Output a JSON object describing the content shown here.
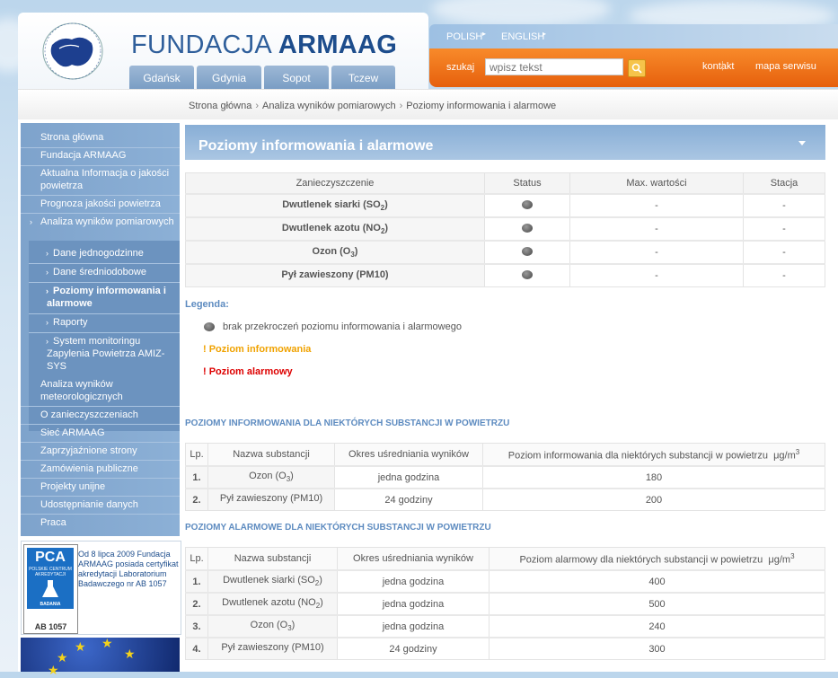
{
  "header": {
    "brand_regular": "FUNDACJA",
    "brand_bold": "ARMAAG",
    "city_tabs": [
      "Gdańsk",
      "Gdynia",
      "Sopot",
      "Tczew"
    ],
    "languages": [
      "POLISH",
      "ENGLISH"
    ],
    "search_label": "szukaj",
    "search_placeholder": "wpisz tekst",
    "links": [
      "kontakt",
      "mapa serwisu"
    ]
  },
  "breadcrumb": [
    "Strona główna",
    "Analiza wyników pomiarowych",
    "Poziomy informowania i alarmowe"
  ],
  "sidebar": {
    "items": [
      {
        "label": "Strona główna"
      },
      {
        "label": "Fundacja ARMAAG"
      },
      {
        "label": "Aktualna Informacja o jakości powietrza"
      },
      {
        "label": "Prognoza jakości powietrza"
      },
      {
        "label": "Analiza wyników pomiarowych"
      },
      {
        "label": "Dane jednogodzinne"
      },
      {
        "label": "Dane średniodobowe"
      },
      {
        "label": "Poziomy informowania i alarmowe"
      },
      {
        "label": "Raporty"
      },
      {
        "label": "System monitoringu Zapylenia Powietrza AMIZ-SYS"
      },
      {
        "label": "Analiza wyników meteorologicznych"
      },
      {
        "label": "O zanieczyszczeniach"
      },
      {
        "label": "Sieć ARMAAG"
      },
      {
        "label": "Zaprzyjaźnione strony"
      },
      {
        "label": "Zamówienia publiczne"
      },
      {
        "label": "Projekty unijne"
      },
      {
        "label": "Udostępnianie danych"
      },
      {
        "label": "Praca"
      }
    ]
  },
  "pca": {
    "logo_text": "PCA",
    "logo_sub": "POLSKIE CENTRUM AKREDYTACJI",
    "logo_badania": "BADANIA",
    "code": "AB 1057",
    "text": "Od 8 lipca 2009 Fundacja ARMAAG posiada certyfikat akredytacji Laboratorium Badawczego nr AB 1057"
  },
  "main": {
    "title": "Poziomy informowania i alarmowe",
    "status_table": {
      "headers": [
        "Zanieczyszczenie",
        "Status",
        "Max. wartości",
        "Stacja"
      ],
      "rows": [
        {
          "name": "Dwutlenek siarki (SO",
          "sub": "2",
          "close": ")",
          "max": "-",
          "station": "-"
        },
        {
          "name": "Dwutlenek azotu (NO",
          "sub": "2",
          "close": ")",
          "max": "-",
          "station": "-"
        },
        {
          "name": "Ozon (O",
          "sub": "3",
          "close": ")",
          "max": "-",
          "station": "-"
        },
        {
          "name": "Pył zawieszony (PM10)",
          "sub": "",
          "close": "",
          "max": "-",
          "station": "-"
        }
      ]
    },
    "legend": {
      "title": "Legenda:",
      "no_exceed": "brak przekroczeń poziomu informowania i alarmowego",
      "info_level": "! Poziom informowania",
      "alarm_level": "! Poziom alarmowy"
    },
    "info_section": {
      "heading": "POZIOMY INFORMOWANIA DLA NIEKTÓRYCH SUBSTANCJI W POWIETRZU",
      "headers": [
        "Lp.",
        "Nazwa substancji",
        "Okres uśredniania wyników",
        "Poziom informowania dla niektórych substancji w powietrzu",
        "μg/m",
        "3"
      ],
      "rows": [
        {
          "lp": "1.",
          "name": "Ozon (O",
          "sub": "3",
          "close": ")",
          "period": "jedna godzina",
          "value": "180"
        },
        {
          "lp": "2.",
          "name": "Pył zawieszony (PM10)",
          "sub": "",
          "close": "",
          "period": "24 godziny",
          "value": "200"
        }
      ]
    },
    "alarm_section": {
      "heading": "POZIOMY ALARMOWE DLA NIEKTÓRYCH SUBSTANCJI W POWIETRZU",
      "headers": [
        "Lp.",
        "Nazwa substancji",
        "Okres uśredniania wyników",
        "Poziom alarmowy dla niektórych substancji w powietrzu",
        "μg/m",
        "3"
      ],
      "rows": [
        {
          "lp": "1.",
          "name": "Dwutlenek siarki (SO",
          "sub": "2",
          "close": ")",
          "period": "jedna godzina",
          "value": "400"
        },
        {
          "lp": "2.",
          "name": "Dwutlenek azotu (NO",
          "sub": "2",
          "close": ")",
          "period": "jedna godzina",
          "value": "500"
        },
        {
          "lp": "3.",
          "name": "Ozon (O",
          "sub": "3",
          "close": ")",
          "period": "jedna godzina",
          "value": "240"
        },
        {
          "lp": "4.",
          "name": "Pył zawieszony (PM10)",
          "sub": "",
          "close": "",
          "period": "24 godziny",
          "value": "300"
        }
      ]
    }
  },
  "colors": {
    "brand_blue": "#2f5f9b",
    "orange_bar": "#f07a1e",
    "sidebar_blue": "#7ea3cc",
    "legend_blue": "#5d8bc0",
    "info_orange": "#f0a200",
    "alarm_red": "#dd0000"
  },
  "icons": {
    "search": "magnifier-icon",
    "status_dot": "gray-circle-icon",
    "nav_arrow": "chevron-right-icon",
    "title_arrow": "triangle-down-icon"
  }
}
